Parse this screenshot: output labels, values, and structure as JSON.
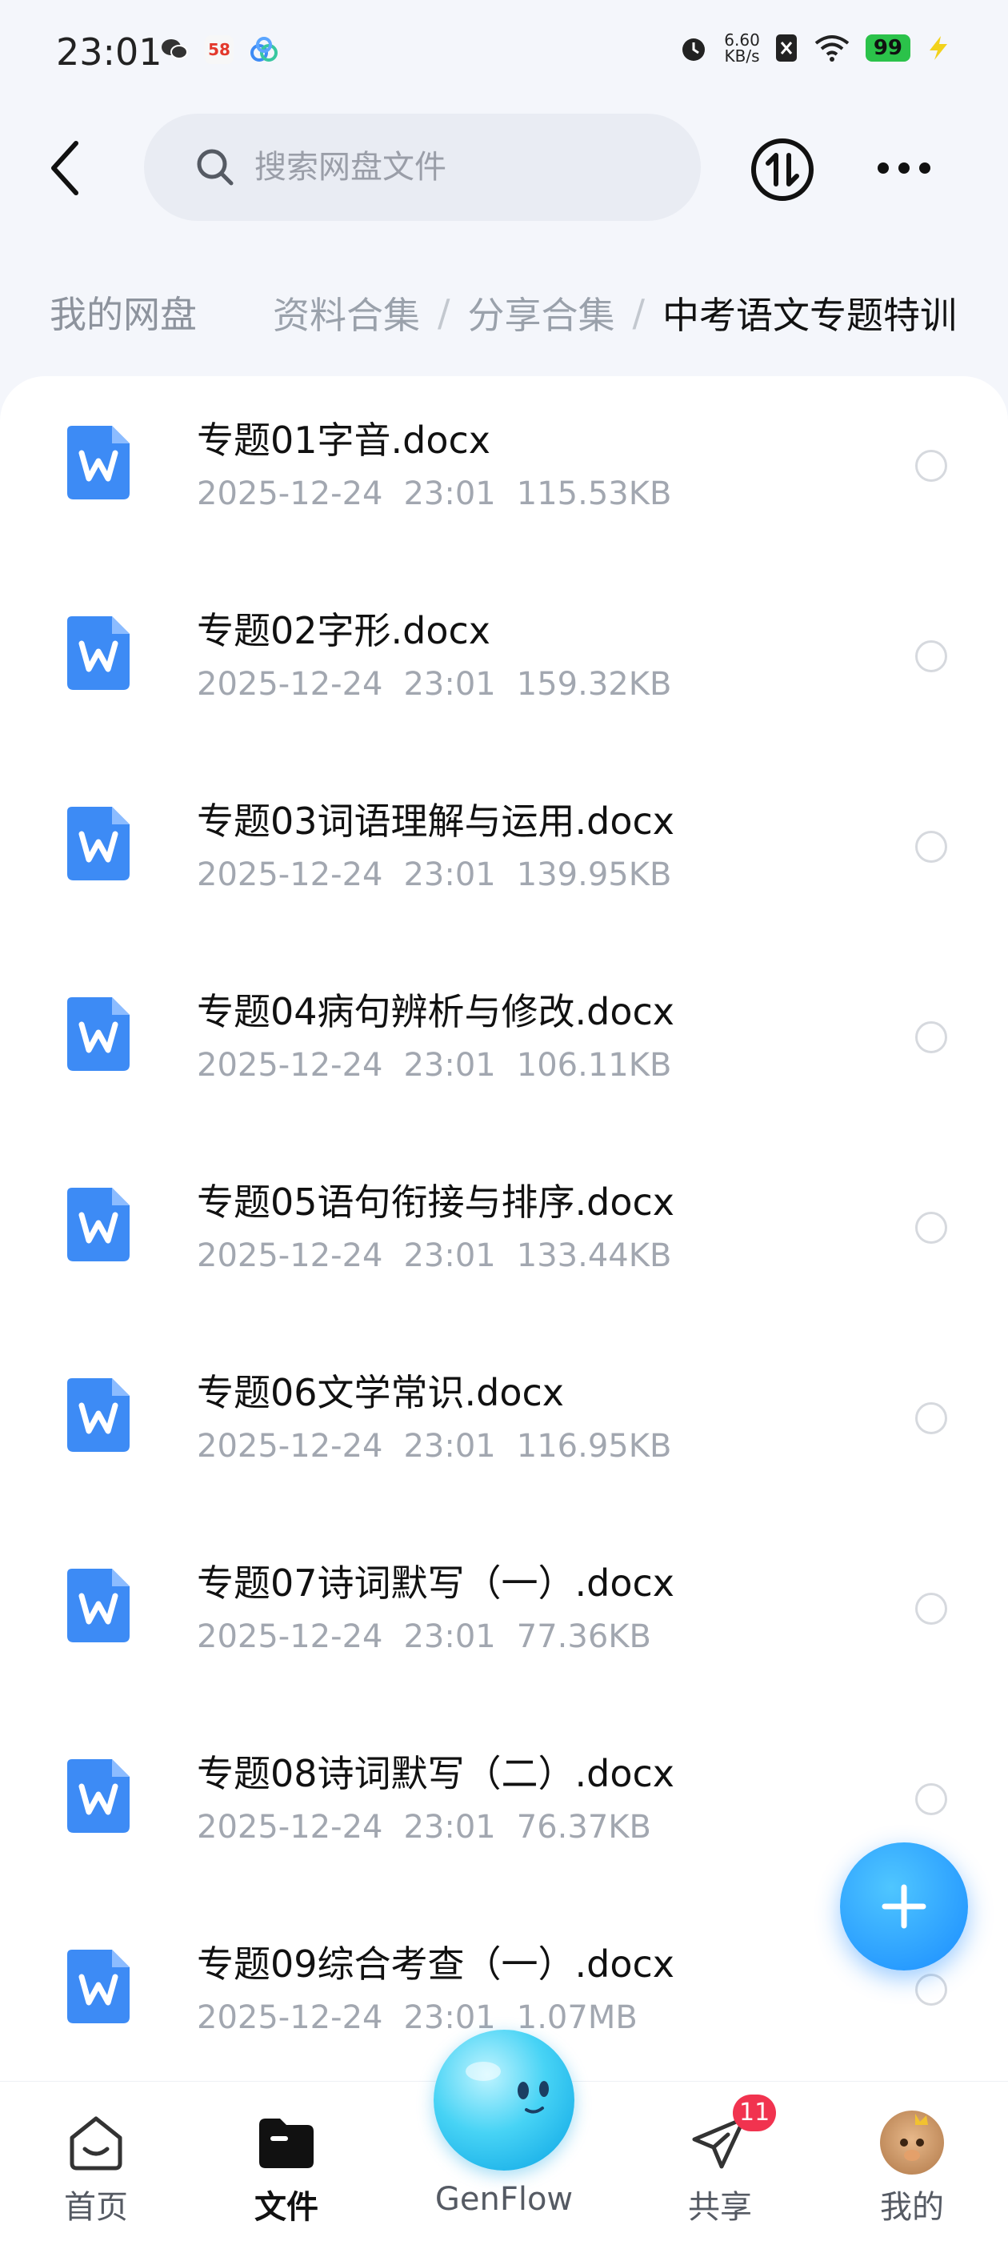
{
  "status_bar": {
    "time": "23:01",
    "net_speed_value": "6.60",
    "net_speed_unit": "KB/s",
    "battery": "99",
    "left_icons": [
      "wechat-icon",
      "app-58-icon",
      "baidu-netdisk-icon"
    ],
    "right_icons": [
      "alarm-icon",
      "sim-off-icon",
      "wifi-icon",
      "battery-icon",
      "charging-icon"
    ],
    "app58_label": "58"
  },
  "header": {
    "search_placeholder": "搜索网盘文件"
  },
  "breadcrumb": {
    "home": "我的网盘",
    "items": [
      "资料合集",
      "分享合集"
    ],
    "separator": "/",
    "current": "中考语文专题特训"
  },
  "files": [
    {
      "name": "专题01字音.docx",
      "date": "2025-12-24",
      "time": "23:01",
      "size": "115.53KB"
    },
    {
      "name": "专题02字形.docx",
      "date": "2025-12-24",
      "time": "23:01",
      "size": "159.32KB"
    },
    {
      "name": "专题03词语理解与运用.docx",
      "date": "2025-12-24",
      "time": "23:01",
      "size": "139.95KB"
    },
    {
      "name": "专题04病句辨析与修改.docx",
      "date": "2025-12-24",
      "time": "23:01",
      "size": "106.11KB"
    },
    {
      "name": "专题05语句衔接与排序.docx",
      "date": "2025-12-24",
      "time": "23:01",
      "size": "133.44KB"
    },
    {
      "name": "专题06文学常识.docx",
      "date": "2025-12-24",
      "time": "23:01",
      "size": "116.95KB"
    },
    {
      "name": "专题07诗词默写（一）.docx",
      "date": "2025-12-24",
      "time": "23:01",
      "size": "77.36KB"
    },
    {
      "name": "专题08诗词默写（二）.docx",
      "date": "2025-12-24",
      "time": "23:01",
      "size": "76.37KB"
    },
    {
      "name": "专题09综合考查（一）.docx",
      "date": "2025-12-24",
      "time": "23:01",
      "size": "1.07MB"
    }
  ],
  "bottom_nav": {
    "items": [
      {
        "label": "首页",
        "icon": "home-icon"
      },
      {
        "label": "文件",
        "icon": "folder-icon",
        "active": true
      },
      {
        "label": "GenFlow",
        "icon": "genflow-orb-icon"
      },
      {
        "label": "共享",
        "icon": "share-plane-icon",
        "badge": "11"
      },
      {
        "label": "我的",
        "icon": "avatar-icon"
      }
    ]
  },
  "colors": {
    "accent": "#1a8cff",
    "doc_icon": "#3d8bf5",
    "badge": "#f1334f",
    "battery": "#2bc24a"
  }
}
